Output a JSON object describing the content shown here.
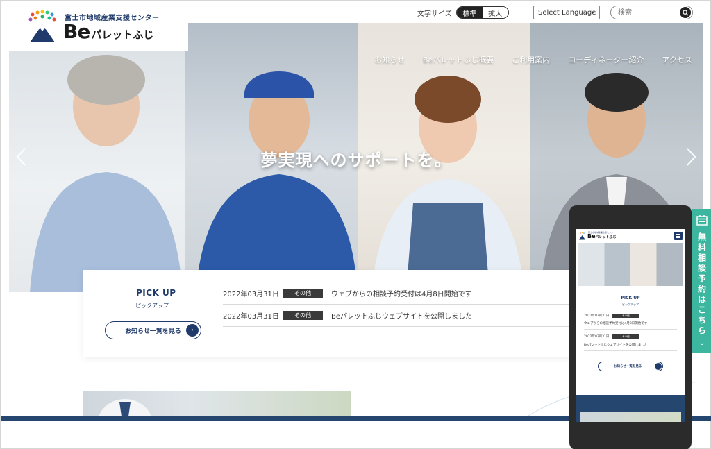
{
  "logo": {
    "subtitle": "富士市地域産業支援センター",
    "main_latin": "Be",
    "main_kana": "パレットふじ"
  },
  "utility": {
    "font_size_label": "文字サイズ",
    "font_standard": "標準",
    "font_large": "拡大",
    "language_select": "Select Language",
    "search_placeholder": "検索"
  },
  "nav": {
    "items": [
      "お知らせ",
      "Beパレットふじ概要",
      "ご利用案内",
      "コーディネーター紹介",
      "アクセス"
    ]
  },
  "hero": {
    "tagline": "夢実現へのサポートを。"
  },
  "pickup": {
    "title": "PICK UP",
    "subtitle": "ピックアップ",
    "button_label": "お知らせ一覧を見る",
    "news": [
      {
        "date": "2022年03月31日",
        "tag": "その他",
        "text": "ウェブからの相談予約受付は4月8日開始です"
      },
      {
        "date": "2022年03月31日",
        "tag": "その他",
        "text": "Beパレットふじウェブサイトを公開しました"
      }
    ]
  },
  "side_tab": {
    "label": "無料相談予約はこちら"
  },
  "mobile": {
    "logo_subtitle": "富士市地域産業支援センター",
    "logo_latin": "Be",
    "logo_kana": "パレットふじ",
    "pickup_title": "PICK UP",
    "pickup_subtitle": "ピックアップ",
    "news": [
      {
        "date": "2022年03月31日",
        "tag": "その他",
        "text": "ウェブからの相談予約受付は4月8日開始です"
      },
      {
        "date": "2022年03月31日",
        "tag": "その他",
        "text": "Beパレットふじウェブサイトを公開しました"
      }
    ],
    "button_label": "お知らせ一覧を見る"
  },
  "colors": {
    "brand_navy": "#1f3a6b",
    "accent_teal": "#3db6a0",
    "tag_dark": "#3a3a3a"
  }
}
